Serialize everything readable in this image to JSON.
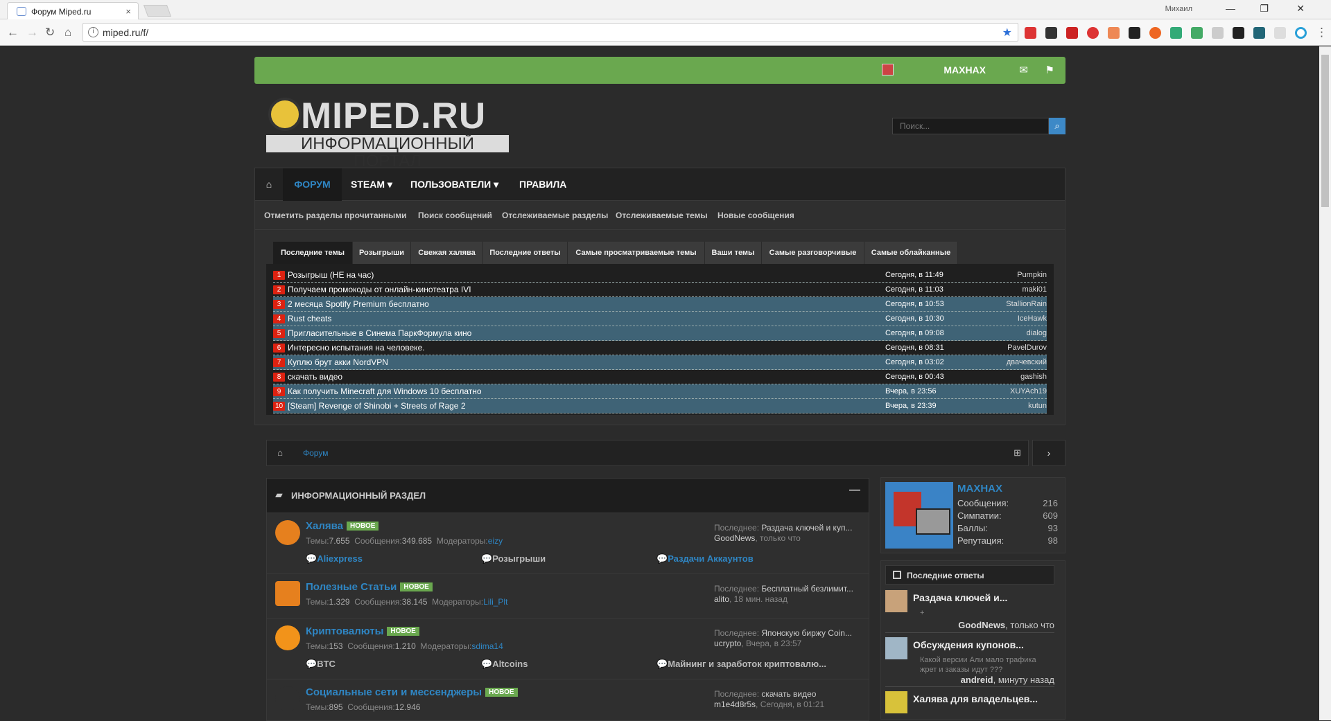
{
  "browser": {
    "tab_title": "Форум Miped.ru",
    "tab_close": "×",
    "url": "miped.ru/f/",
    "profile_name": "Михаил",
    "window_controls": {
      "minimize": "—",
      "maximize": "❐",
      "close": "✕"
    }
  },
  "site": {
    "header": {
      "username": "MAXHAX",
      "mail_icon": "✉",
      "flag_icon": "⚑"
    },
    "logo": {
      "title": "MIPED.RU",
      "subtitle": "ИНФОРМАЦИОННЫЙ ПОРТАЛ"
    },
    "search": {
      "placeholder": "Поиск...",
      "icon": "⌕"
    },
    "nav": {
      "home_icon": "⌂",
      "items": [
        {
          "label": "ФОРУМ"
        },
        {
          "label": "STEAM ▾"
        },
        {
          "label": "ПОЛЬЗОВАТЕЛИ ▾"
        },
        {
          "label": "ПРАВИЛА"
        }
      ]
    },
    "subnav": [
      "Отметить разделы прочитанными",
      "Поиск сообщений",
      "Отслеживаемые разделы",
      "Отслеживаемые темы",
      "Новые сообщения"
    ],
    "topic_tabs": [
      "Последние темы",
      "Розыгрыши",
      "Свежая халява",
      "Последние ответы",
      "Самые просматриваемые темы",
      "Ваши темы",
      "Самые разговорчивые",
      "Самые облайканные"
    ],
    "topics": [
      {
        "n": "1",
        "title": "Розыгрыш (НЕ на час)",
        "time": "Сегодня, в 11:49",
        "author": "Pumpkin"
      },
      {
        "n": "2",
        "title": "Получаем промокоды от онлайн-кинотеатра IVI",
        "time": "Сегодня, в 11:03",
        "author": "maki01"
      },
      {
        "n": "3",
        "title": "2 месяца Spotify Premium бесплатно",
        "time": "Сегодня, в 10:53",
        "author": "StallionRain"
      },
      {
        "n": "4",
        "title": "Rust cheats",
        "time": "Сегодня, в 10:30",
        "author": "IceHawk"
      },
      {
        "n": "5",
        "title": "Пригласительные в Синема ПаркФормула кино",
        "time": "Сегодня, в 09:08",
        "author": "dialog"
      },
      {
        "n": "6",
        "title": "Интересно испытания на человеке.",
        "time": "Сегодня, в 08:31",
        "author": "PavelDurov"
      },
      {
        "n": "7",
        "title": "Куплю брут акки NordVPN",
        "time": "Сегодня, в 03:02",
        "author": "двачевский"
      },
      {
        "n": "8",
        "title": "скачать видео",
        "time": "Сегодня, в 00:43",
        "author": "gashish"
      },
      {
        "n": "9",
        "title": "Как получить Minecraft для Windows 10 бесплатно",
        "time": "Вчера, в 23:56",
        "author": "XUYAch19"
      },
      {
        "n": "10",
        "title": "[Steam] Revenge of Shinobi + Streets of Rage 2",
        "time": "Вчера, в 23:39",
        "author": "kutun"
      }
    ],
    "breadcrumb": {
      "home_icon": "⌂",
      "forum": "Форум",
      "sitemap_icon": "⊞",
      "next_icon": "›"
    },
    "section": {
      "title": "ИНФОРМАЦИОННЫЙ РАЗДЕЛ",
      "folder_icon": "▰",
      "collapse": "—"
    },
    "forums": [
      {
        "name": "Халява",
        "badge": "НОВОЕ",
        "topics_label": "Темы:",
        "topics": "7.655",
        "msgs_label": "Сообщения:",
        "msgs": "349.685",
        "mods_label": "Модераторы:",
        "mods": "eizy",
        "last_label": "Последнее:",
        "last_title": "Раздача ключей и куп...",
        "last_by": "GoodNews",
        "last_time": ", только что",
        "subs": [
          "Aliexpress",
          "Розыгрыши",
          "Раздачи Аккаунтов"
        ],
        "icon_color": "#e6801e"
      },
      {
        "name": "Полезные Статьи",
        "badge": "НОВОЕ",
        "topics_label": "Темы:",
        "topics": "1.329",
        "msgs_label": "Сообщения:",
        "msgs": "38.145",
        "mods_label": "Модераторы:",
        "mods": "Lili_Plt",
        "last_label": "Последнее:",
        "last_title": "Бесплатный безлимит...",
        "last_by": "alito",
        "last_time": ", 18 мин. назад",
        "icon_color": "#e6801e"
      },
      {
        "name": "Криптовалюты",
        "badge": "НОВОЕ",
        "topics_label": "Темы:",
        "topics": "153",
        "msgs_label": "Сообщения:",
        "msgs": "1.210",
        "mods_label": "Модераторы:",
        "mods": "sdima14",
        "last_label": "Последнее:",
        "last_title": "Японскую биржу Coin...",
        "last_by": "ucrypto",
        "last_time": ", Вчера, в 23:57",
        "subs": [
          "BTC",
          "Altcoins",
          "Майнинг и заработок криптовалю..."
        ],
        "icon_color": "#f2931a"
      },
      {
        "name": "Социальные сети и мессенджеры",
        "badge": "НОВОЕ",
        "topics_label": "Темы:",
        "topics": "895",
        "msgs_label": "Сообщения:",
        "msgs": "12.946",
        "last_label": "Последнее:",
        "last_title": "скачать видео",
        "last_by": "m1e4d8r5s",
        "last_time": ", Сегодня, в 01:21",
        "icon_color": "#2f2f2f"
      }
    ],
    "sidebar": {
      "user": {
        "name": "MAXHAX",
        "stats": [
          {
            "k": "Сообщения:",
            "v": "216"
          },
          {
            "k": "Симпатии:",
            "v": "609"
          },
          {
            "k": "Баллы:",
            "v": "93"
          },
          {
            "k": "Репутация:",
            "v": "98"
          }
        ]
      },
      "recent": {
        "title": "Последние ответы",
        "items": [
          {
            "title": "Раздача ключей и...",
            "excerpt": "+",
            "by": "GoodNews",
            "when": ", только что"
          },
          {
            "title": "Обсуждения купонов...",
            "excerpt": "Какой версии Али мало трафика жрет и заказы идут ???",
            "by": "andreid",
            "when": ", минуту назад"
          },
          {
            "title": "Халява для владельцев...",
            "excerpt": "",
            "by": "",
            "when": ""
          }
        ]
      }
    }
  }
}
